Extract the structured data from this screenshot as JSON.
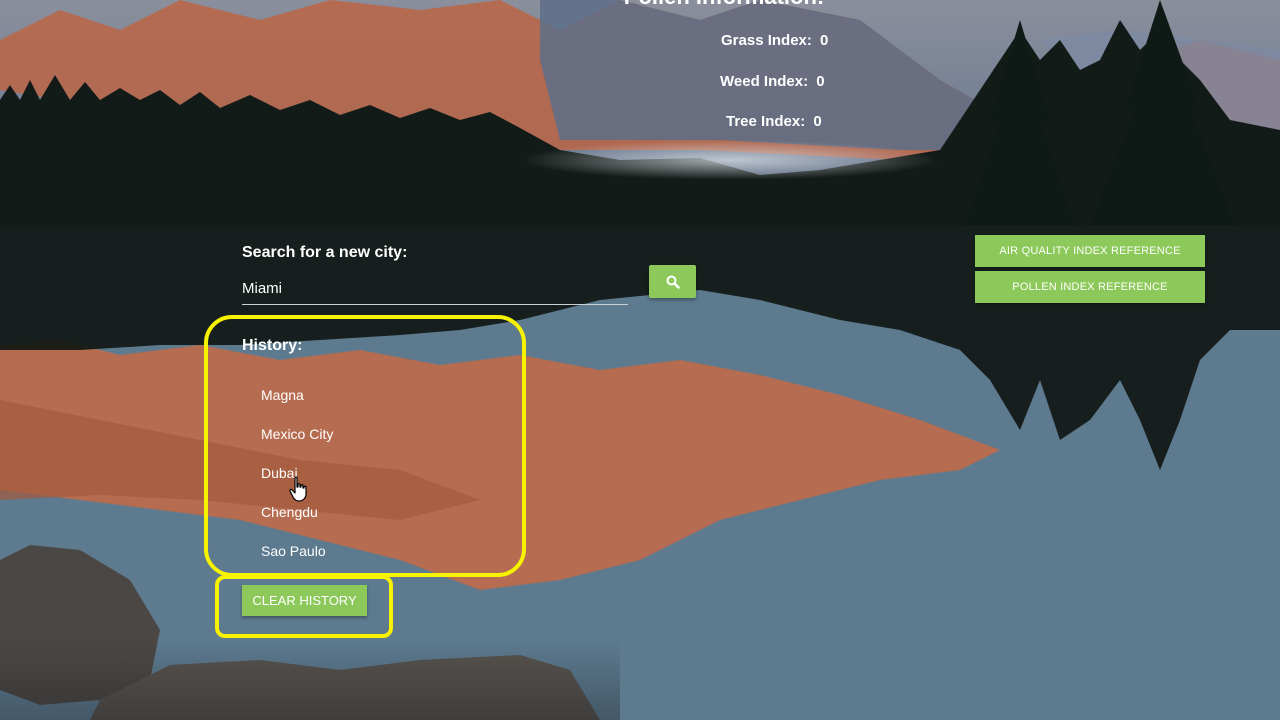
{
  "pollen": {
    "title": "Pollen Information:",
    "grass": {
      "label": "Grass Index:",
      "value": "0"
    },
    "weed": {
      "label": "Weed Index:",
      "value": "0"
    },
    "tree": {
      "label": "Tree Index:",
      "value": "0"
    }
  },
  "search": {
    "label": "Search for a new city:",
    "value": "Miami",
    "button_icon": "search-icon"
  },
  "references": {
    "air_quality_label": "AIR QUALITY INDEX REFERENCE",
    "pollen_label": "POLLEN INDEX REFERENCE"
  },
  "history": {
    "label": "History:",
    "items": [
      "Magna",
      "Mexico City",
      "Dubai",
      "Chengdu",
      "Sao Paulo"
    ],
    "clear_label": "CLEAR HISTORY"
  },
  "colors": {
    "accent_button": "#8cc95a",
    "highlight": "#f7f200"
  }
}
